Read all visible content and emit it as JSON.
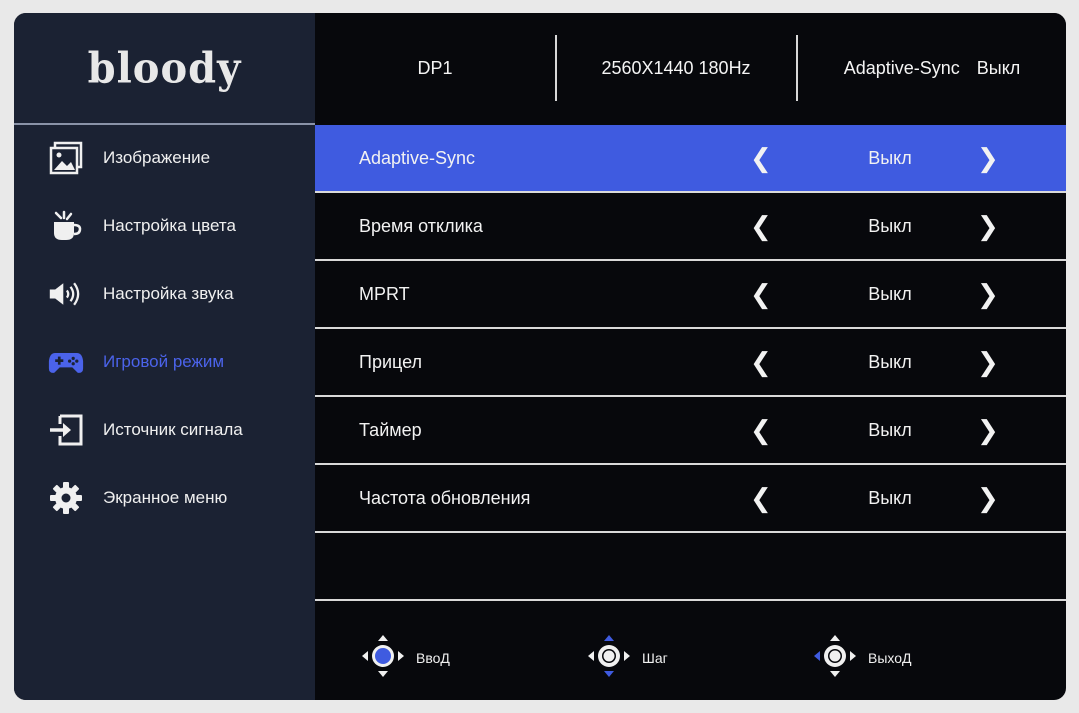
{
  "brand": "bloody",
  "header": {
    "input": "DP1",
    "resolution": "2560X1440 180Hz",
    "sync_label": "Adaptive-Sync",
    "sync_value": "Выкл"
  },
  "sidebar": {
    "items": [
      {
        "label": "Изображение",
        "icon": "image-icon"
      },
      {
        "label": "Настройка цвета",
        "icon": "color-cup-icon"
      },
      {
        "label": "Настройка звука",
        "icon": "speaker-icon"
      },
      {
        "label": "Игровой режим",
        "icon": "gamepad-icon",
        "active": true
      },
      {
        "label": "Источник сигнала",
        "icon": "input-source-icon"
      },
      {
        "label": "Экранное меню",
        "icon": "gear-icon"
      }
    ]
  },
  "settings": {
    "rows": [
      {
        "label": "Adaptive-Sync",
        "value": "Выкл",
        "selected": true
      },
      {
        "label": "Время отклика",
        "value": "Выкл"
      },
      {
        "label": "MPRT",
        "value": "Выкл"
      },
      {
        "label": "Прицел",
        "value": "Выкл"
      },
      {
        "label": "Таймер",
        "value": "Выкл"
      },
      {
        "label": "Частота обновления",
        "value": "Выкл"
      }
    ],
    "prev_glyph": "❮",
    "next_glyph": "❯"
  },
  "footer": {
    "hints": [
      {
        "label": "ВвоД",
        "icon": "joystick-press-icon"
      },
      {
        "label": "Шаг",
        "icon": "joystick-updown-icon"
      },
      {
        "label": "ВыхоД",
        "icon": "joystick-left-icon"
      }
    ]
  },
  "colors": {
    "accent": "#3f5be0",
    "active_text": "#4b63ea",
    "sidebar_bg": "#1b2233",
    "panel_bg": "#07080c"
  }
}
